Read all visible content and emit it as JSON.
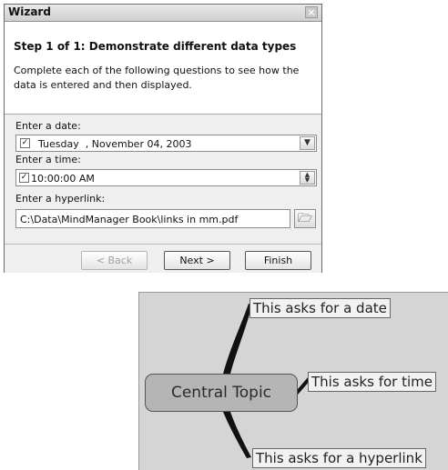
{
  "wizard": {
    "title": "Wizard",
    "close_glyph": "×",
    "step_title": "Step 1 of 1: Demonstrate different data types",
    "description": "Complete each of the following questions to see how the data is entered and then displayed.",
    "date_label": "Enter a date:",
    "date_value": "Tuesday  , November 04, 2003",
    "date_checked": true,
    "time_label": "Enter a time:",
    "time_value": "10:00:00 AM",
    "time_checked": true,
    "hyperlink_label": "Enter a hyperlink:",
    "hyperlink_value": "C:\\Data\\MindManager Book\\links in mm.pdf",
    "back_label": "< Back",
    "next_label": "Next >",
    "finish_label": "Finish",
    "icons": {
      "date_dropdown": "chevron-down-icon",
      "time_spinner": "up-down-spinner-icon",
      "browse": "open-folder-icon",
      "check": "checkmark-icon"
    }
  },
  "mindmap": {
    "central_topic": "Central Topic",
    "subtopics": [
      "This asks for a date",
      "This asks for time",
      "This asks for a hyperlink"
    ]
  },
  "colors": {
    "dialog_body": "#efefef",
    "map_background": "#d5d5d5",
    "central_topic_fill": "#b5b5b5"
  }
}
